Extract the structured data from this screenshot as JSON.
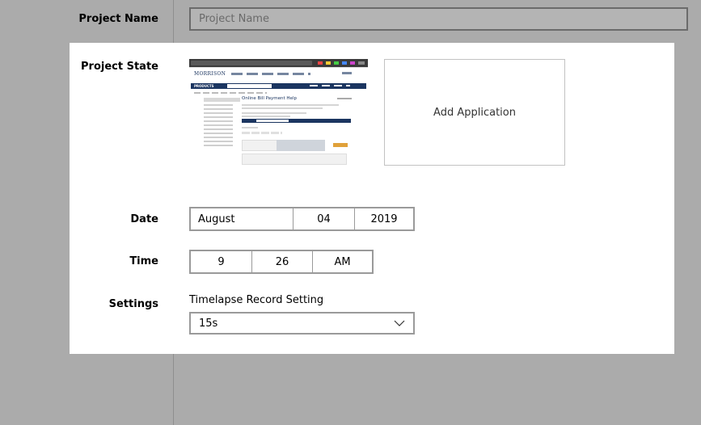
{
  "labels": {
    "project_name": "Project Name",
    "project_state": "Project State",
    "date": "Date",
    "time": "Time",
    "settings": "Settings"
  },
  "project_name_input": {
    "placeholder": "Project Name",
    "value": ""
  },
  "project_state": {
    "screenshot_page_title": "Online Bill Payment Help",
    "screenshot_logo": "MORRISON",
    "screenshot_products": "PRODUCTS",
    "add_application_label": "Add Application"
  },
  "date": {
    "month": "August",
    "day": "04",
    "year": "2019"
  },
  "time": {
    "hour": "9",
    "minute": "26",
    "period": "AM"
  },
  "settings": {
    "timelapse_label": "Timelapse Record Setting",
    "timelapse_value": "15s"
  },
  "icons": {
    "dropdown": "chevron-down-icon"
  },
  "colors": {
    "background": "#ababab",
    "panel": "#ffffff",
    "border": "#9a9a9a"
  }
}
